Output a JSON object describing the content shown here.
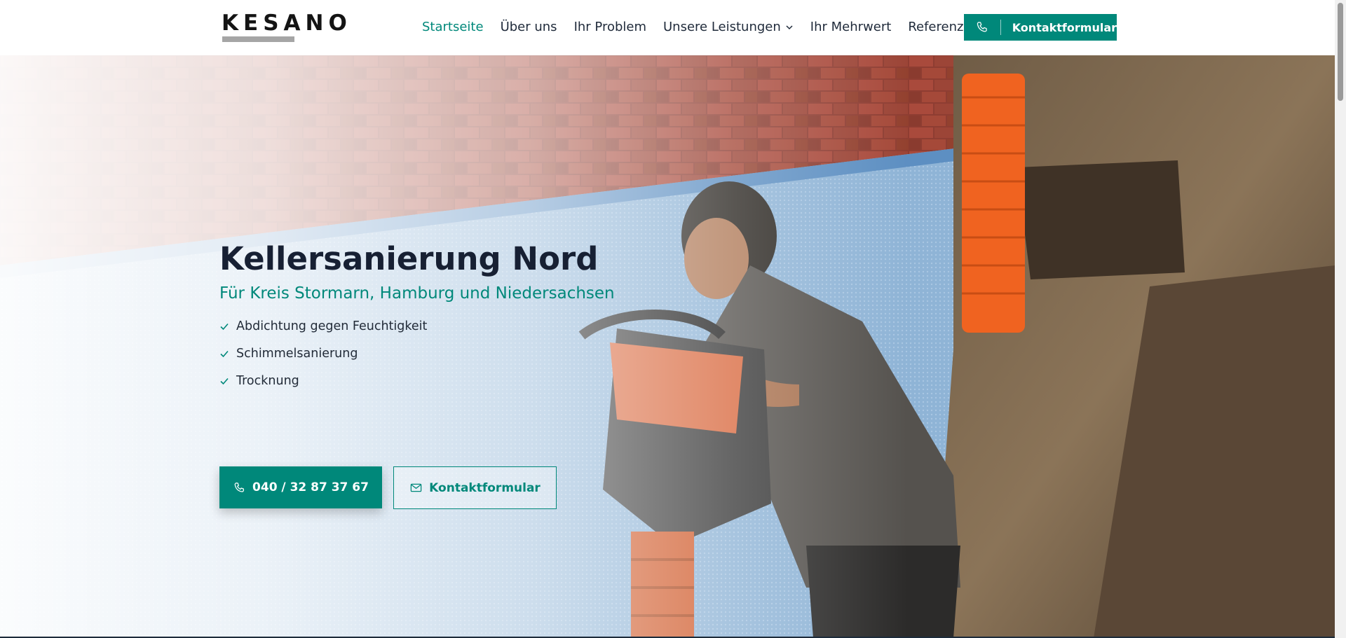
{
  "brand": {
    "logo_text": "KESANO",
    "accent_color": "#00887a",
    "text_color": "#172033"
  },
  "nav": {
    "items": [
      {
        "label": "Startseite",
        "active": true
      },
      {
        "label": "Über uns",
        "active": false
      },
      {
        "label": "Ihr Problem",
        "active": false
      },
      {
        "label": "Unsere Leistungen",
        "active": false,
        "has_dropdown": true
      },
      {
        "label": "Ihr Mehrwert",
        "active": false
      },
      {
        "label": "Referenzen",
        "active": false
      }
    ],
    "cta": {
      "label": "Kontaktformular",
      "icon": "phone-icon"
    }
  },
  "hero": {
    "title": "Kellersanierung Nord",
    "subtitle": "Für Kreis Stormarn, Hamburg und Niedersachsen",
    "features": [
      "Abdichtung gegen Feuchtigkeit",
      "Schimmelsanierung",
      "Trocknung"
    ],
    "phone_button": {
      "label": "040 / 32 87 37 67",
      "icon": "phone-icon"
    },
    "contact_button": {
      "label": "Kontaktformular",
      "icon": "mail-icon"
    }
  }
}
